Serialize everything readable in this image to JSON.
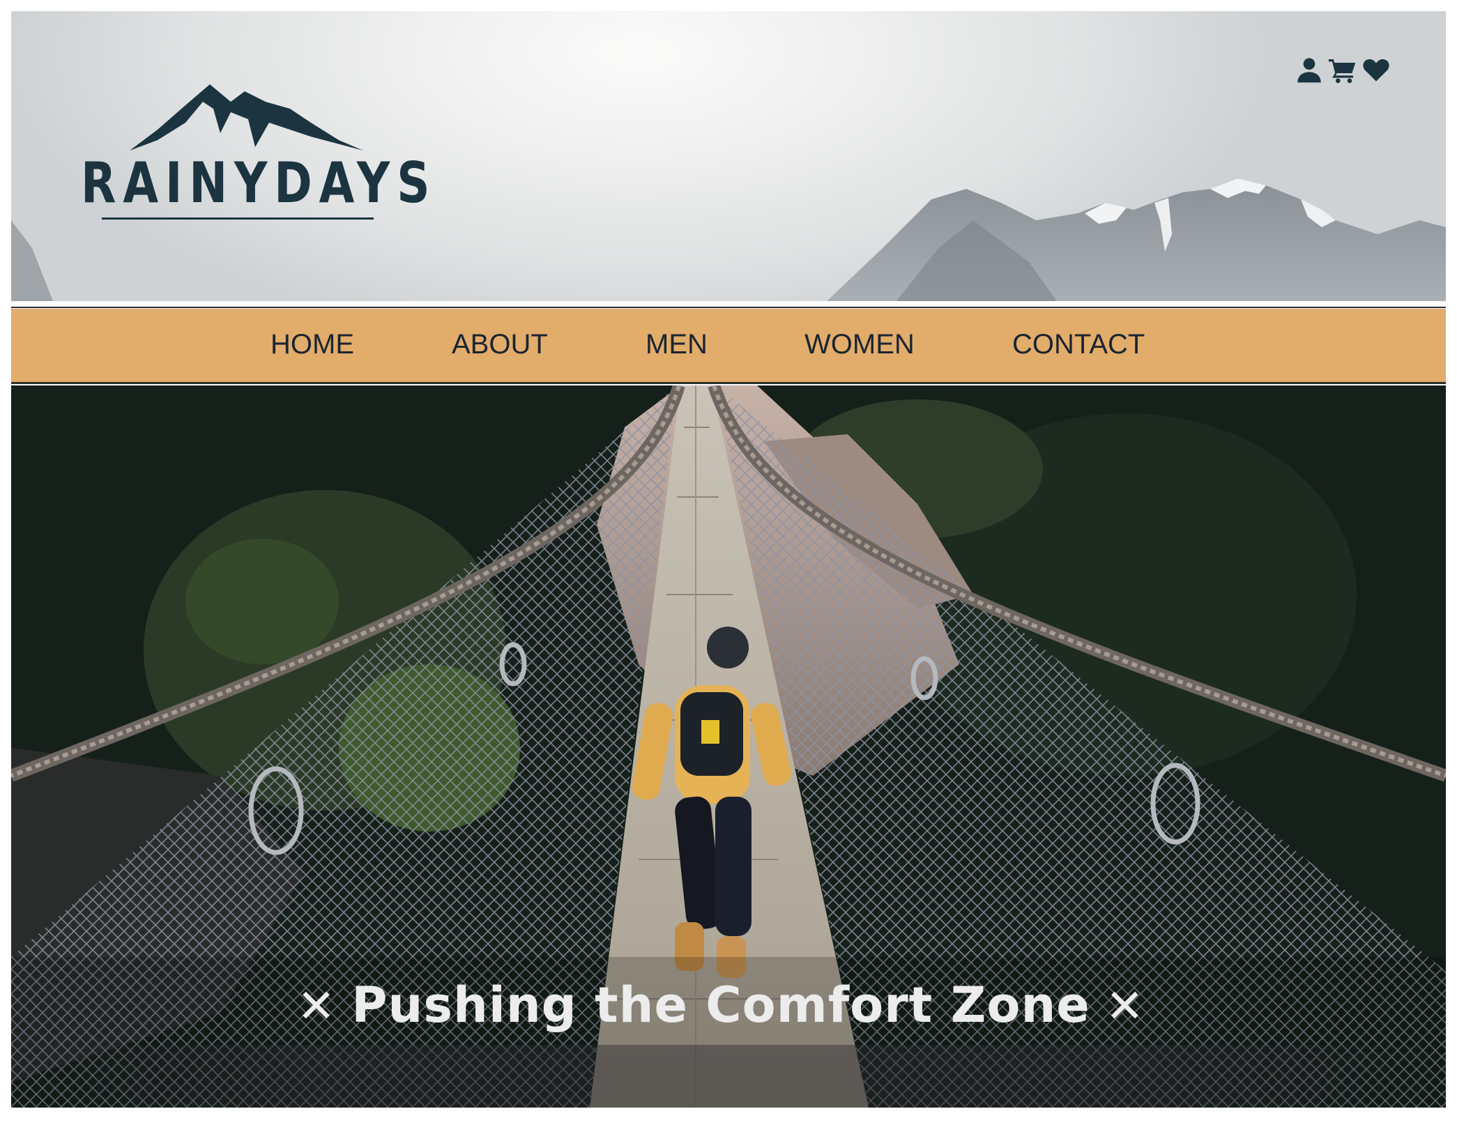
{
  "brand": {
    "name": "RAINYDAYS",
    "logo_color": "#1b3440"
  },
  "header_icons": [
    {
      "name": "user-icon"
    },
    {
      "name": "cart-icon"
    },
    {
      "name": "heart-icon"
    }
  ],
  "nav": {
    "background": "#e2ac6b",
    "items": [
      {
        "label": "HOME"
      },
      {
        "label": "ABOUT"
      },
      {
        "label": "MEN"
      },
      {
        "label": "WOMEN"
      },
      {
        "label": "CONTACT"
      }
    ]
  },
  "hero": {
    "caption": "Pushing the Comfort Zone",
    "caption_mark": "✕"
  }
}
